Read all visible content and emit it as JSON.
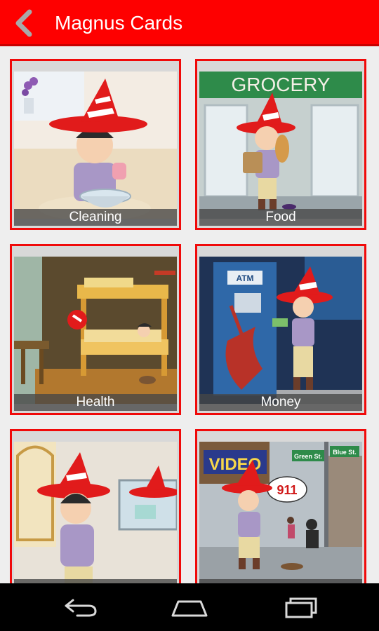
{
  "app": {
    "title": "Magnus Cards"
  },
  "colors": {
    "appbar": "#fe0000",
    "card_border": "#f00a0a",
    "navbar": "#000000"
  },
  "cards": [
    {
      "label": "Cleaning",
      "art": {
        "grocery_sign": "",
        "atm": "",
        "video_sign": "",
        "street1": "",
        "street2": "",
        "bubble": ""
      }
    },
    {
      "label": "Food",
      "art": {
        "grocery_sign": "GROCERY"
      }
    },
    {
      "label": "Health"
    },
    {
      "label": "Money",
      "art": {
        "atm": "ATM"
      }
    },
    {
      "label": ""
    },
    {
      "label": "",
      "art": {
        "video_sign": "VIDEO",
        "street1": "Green St.",
        "street2": "Blue St.",
        "bubble": "911"
      }
    }
  ],
  "navbar": {
    "icons": [
      "back-icon",
      "home-icon",
      "recents-icon"
    ]
  }
}
